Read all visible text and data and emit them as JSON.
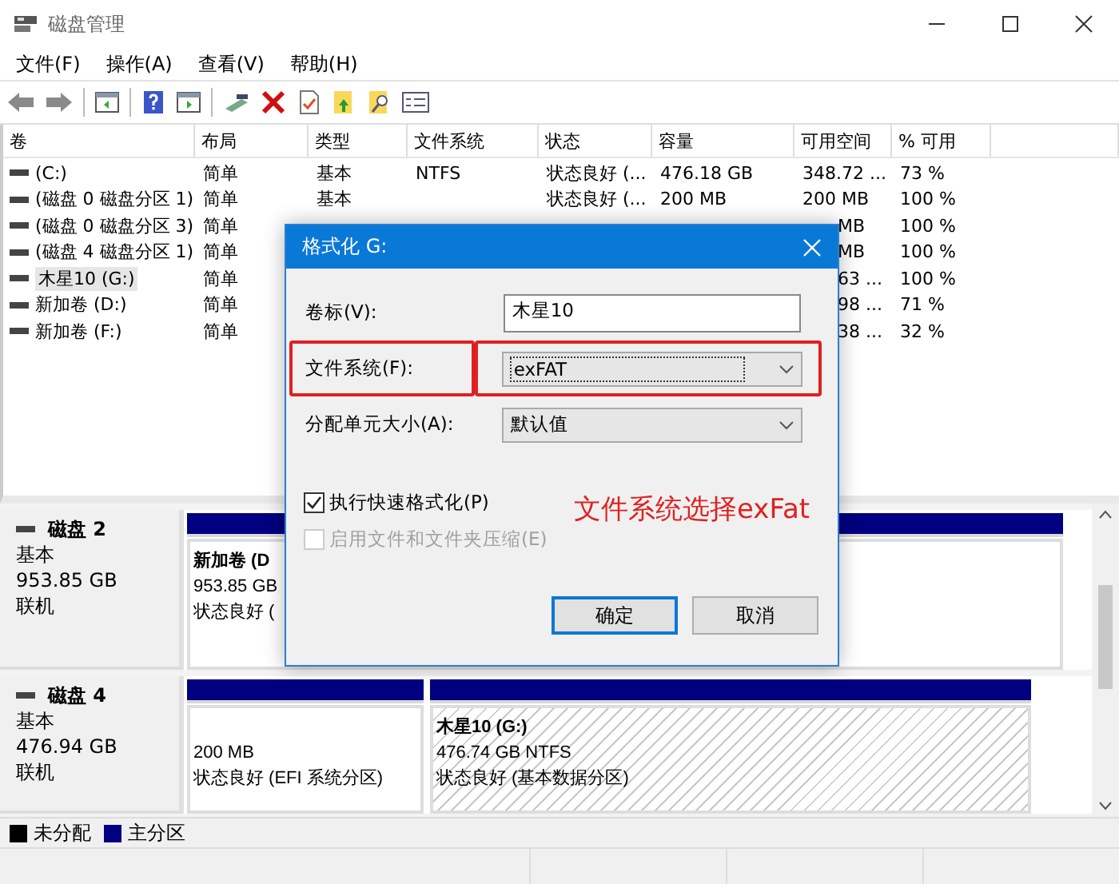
{
  "window": {
    "title": "磁盘管理"
  },
  "menu": [
    "文件(F)",
    "操作(A)",
    "查看(V)",
    "帮助(H)"
  ],
  "table": {
    "columns": [
      "卷",
      "布局",
      "类型",
      "文件系统",
      "状态",
      "容量",
      "可用空间",
      "% 可用"
    ],
    "rows": [
      {
        "volume": "(C:)",
        "layout": "简单",
        "type": "基本",
        "fs": "NTFS",
        "status": "状态良好 (...",
        "capacity": "476.18 GB",
        "free": "348.72 ...",
        "pct": "73 %",
        "selected": false
      },
      {
        "volume": "(磁盘 0 磁盘分区 1)",
        "layout": "简单",
        "type": "基本",
        "status": "状态良好 (...",
        "capacity": "200 MB",
        "free": "200 MB",
        "pct": "100 %",
        "selected": false
      },
      {
        "volume": "(磁盘 0 磁盘分区 3)",
        "layout": "简单",
        "free": "MB",
        "pct": "100 %",
        "selected": false
      },
      {
        "volume": "(磁盘 4 磁盘分区 1)",
        "layout": "简单",
        "free": "MB",
        "pct": "100 %",
        "selected": false
      },
      {
        "volume": "木星10 (G:)",
        "layout": "简单",
        "free": "63 ...",
        "pct": "100 %",
        "selected": true
      },
      {
        "volume": "新加卷 (D:)",
        "layout": "简单",
        "free": "98 ...",
        "pct": "71 %",
        "selected": false
      },
      {
        "volume": "新加卷 (F:)",
        "layout": "简单",
        "free": "38 ...",
        "pct": "32 %",
        "selected": false
      }
    ]
  },
  "disks": [
    {
      "name": "磁盘 2",
      "type": "基本",
      "size": "953.85 GB",
      "status": "联机",
      "partitions": [
        {
          "title": "新加卷 (D",
          "size": "953.85 GB",
          "status": "状态良好 (",
          "selected": false
        }
      ]
    },
    {
      "name": "磁盘 4",
      "type": "基本",
      "size": "476.94 GB",
      "status": "联机",
      "partitions": [
        {
          "size": "200 MB",
          "status": "状态良好 (EFI 系统分区)",
          "selected": false
        },
        {
          "title": "木星10 (G:)",
          "size": "476.74 GB NTFS",
          "status": "状态良好 (基本数据分区)",
          "selected": true
        }
      ]
    }
  ],
  "legend": [
    {
      "label": "未分配",
      "color": "#000000"
    },
    {
      "label": "主分区",
      "color": "#000080"
    }
  ],
  "dialog": {
    "title": "格式化 G:",
    "fields": [
      {
        "label": "卷标(V):",
        "kind": "text",
        "value": "木星10",
        "highlighted": false
      },
      {
        "label": "文件系统(F):",
        "kind": "combo",
        "value": "exFAT",
        "highlighted": true
      },
      {
        "label": "分配单元大小(A):",
        "kind": "combo",
        "value": "默认值",
        "highlighted": false
      }
    ],
    "options": [
      {
        "label": "执行快速格式化(P)",
        "checked": true,
        "disabled": false
      },
      {
        "label": "启用文件和文件夹压缩(E)",
        "checked": false,
        "disabled": true
      }
    ],
    "buttons": [
      {
        "label": "确定",
        "default": true
      },
      {
        "label": "取消",
        "default": false
      }
    ],
    "annotation": "文件系统选择exFat"
  }
}
